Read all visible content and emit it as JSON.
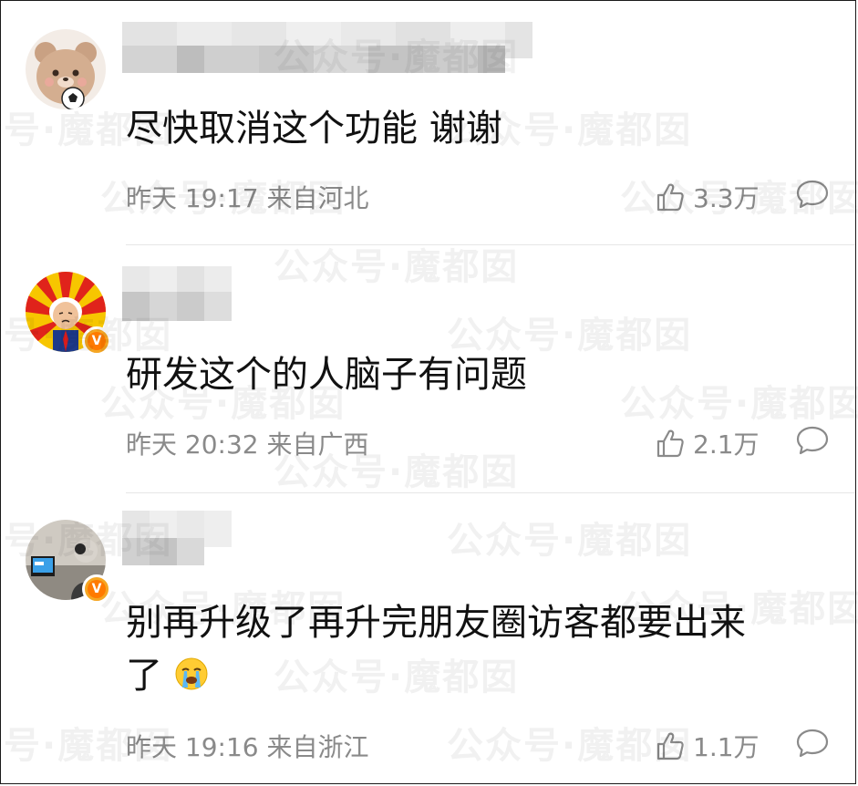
{
  "watermark_text": "公众号·魔都囡",
  "comments": [
    {
      "content": "尽快取消这个功能 谢谢",
      "time": "昨天 19:17",
      "location": "来自河北",
      "likes": "3.3万"
    },
    {
      "content": "研发这个的人脑子有问题",
      "time": "昨天 20:32",
      "location": "来自广西",
      "likes": "2.1万"
    },
    {
      "content_line1": "别再升级了再升完朋友圈访客都要出来",
      "content_line2": "了",
      "time": "昨天 19:16",
      "location": "来自浙江",
      "likes": "1.1万"
    }
  ],
  "icons": {
    "like": "thumbs-up-icon",
    "reply": "comment-bubble-icon",
    "verified": "verified-v-badge-icon",
    "crying_emoji": "crying-face-emoji"
  },
  "colors": {
    "text": "#111111",
    "meta": "#8a8a8a",
    "badge": "#ff7a00"
  }
}
